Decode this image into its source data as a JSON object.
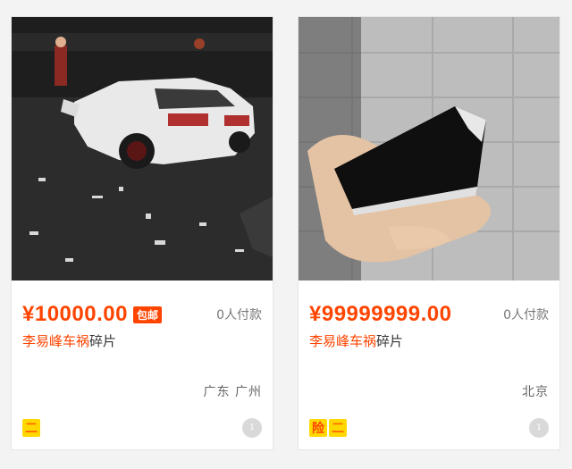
{
  "items": [
    {
      "price": "¥10000.00",
      "badge": "包邮",
      "paid_count": "0人付款",
      "title_keyword": "李易峰车祸",
      "title_rest": "碎片",
      "location": "广东 广州",
      "tags": [
        "二"
      ],
      "image": "night car crash scene",
      "seller_avatar_text": "1"
    },
    {
      "price": "¥99999999.00",
      "badge": "",
      "paid_count": "0人付款",
      "title_keyword": "李易峰车祸",
      "title_rest": "碎片",
      "location": "北京",
      "tags": [
        "险",
        "二"
      ],
      "image": "hand holding black car fragment",
      "seller_avatar_text": "1"
    }
  ],
  "colors": {
    "accent": "#ff4400",
    "tag_bg": "#ffd800",
    "bg": "#f3f3f3"
  }
}
